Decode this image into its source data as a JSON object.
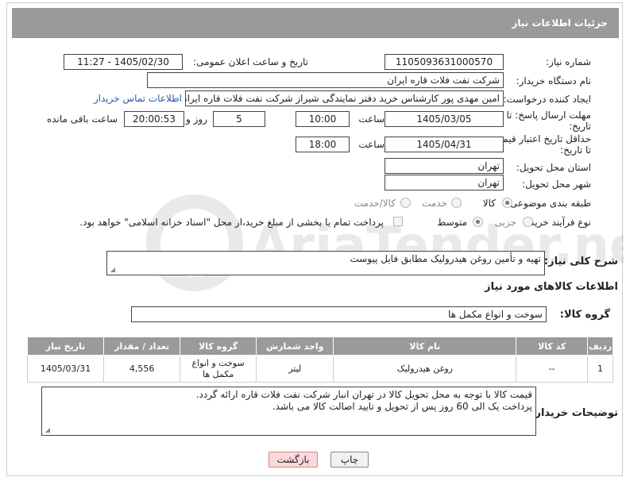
{
  "header": {
    "title": "جزئیات اطلاعات نیاز"
  },
  "fields": {
    "need_number": {
      "label": "شماره نیاز:",
      "value": "1105093631000570"
    },
    "announce_datetime": {
      "label": "تاریخ و ساعت اعلان عمومی:",
      "value": "1405/02/30 - 11:27"
    },
    "buyer_org": {
      "label": "نام دستگاه خریدار:",
      "value": "شرکت نفت فلات قاره ایران"
    },
    "requester": {
      "label": "ایجاد کننده درخواست:",
      "value": "امین مهدی پور کارشناس خرید دفتر نمایندگی شیراز شرکت نفت فلات قاره ایران",
      "contact_link": "اطلاعات تماس خریدار"
    },
    "reply_deadline": {
      "label_line1": "مهلت ارسال پاسخ: تا",
      "label_line2": "تاریخ:",
      "date": "1405/03/05",
      "time_label": "ساعت",
      "time": "10:00",
      "days": "5",
      "days_label": "روز و",
      "remaining": "20:00:53",
      "remaining_label": "ساعت باقی مانده"
    },
    "price_validity": {
      "label_line1": "حداقل تاریخ اعتبار قیمت:",
      "label_line2": "تا تاریخ:",
      "date": "1405/04/31",
      "time_label": "ساعت",
      "time": "18:00"
    },
    "delivery_province": {
      "label": "استان محل تحویل:",
      "value": "تهران"
    },
    "delivery_city": {
      "label": "شهر محل تحویل:",
      "value": "تهران"
    },
    "category": {
      "label": "طبقه بندی موضوعی:",
      "options": [
        "کالا",
        "خدمت",
        "کالا/خدمت"
      ],
      "selected": "کالا"
    },
    "purchase_type": {
      "label": "نوع فرآیند خرید :",
      "options": [
        "جزیی",
        "متوسط"
      ],
      "selected": "متوسط",
      "payment_note": "پرداخت تمام یا بخشی از مبلغ خرید،از محل \"اسناد خزانه اسلامی\" خواهد بود."
    }
  },
  "description": {
    "label": "شرح کلی نیاز:",
    "value": "تهیه و تأمین روغن هیدرولیک مطابق فایل پیوست"
  },
  "goods_section": {
    "title": "اطلاعات کالاهای مورد نیاز",
    "group_label": "گروه کالا:",
    "group_value": "سوخت و انواع مکمل ها"
  },
  "table": {
    "headers": [
      "ردیف",
      "کد کالا",
      "نام کالا",
      "واحد شمارش",
      "گروه کالا",
      "تعداد / مقدار",
      "تاریخ نیاز"
    ],
    "rows": [
      [
        "1",
        "--",
        "روغن هیدرولیک",
        "لیتر",
        "سوخت و انواع مکمل ها",
        "4,556",
        "1405/03/31"
      ]
    ]
  },
  "buyer_notes": {
    "label": "توضیحات خریدار:",
    "line1": "قیمت کالا با توجه به محل تحویل کالا در تهران انبار شرکت نفت فلات قاره ارائه گردد.",
    "line2": "پرداخت  یک الی 60 روز پس از تحویل و تایید اصالت کالا می باشد."
  },
  "buttons": {
    "print": "چاپ",
    "back": "بازگشت"
  },
  "watermark": {
    "text": "AriaTender.neT"
  },
  "colors": {
    "header_bg": "#9a9a9a",
    "link": "#2a5db0",
    "back_button": "#fbd9db"
  }
}
